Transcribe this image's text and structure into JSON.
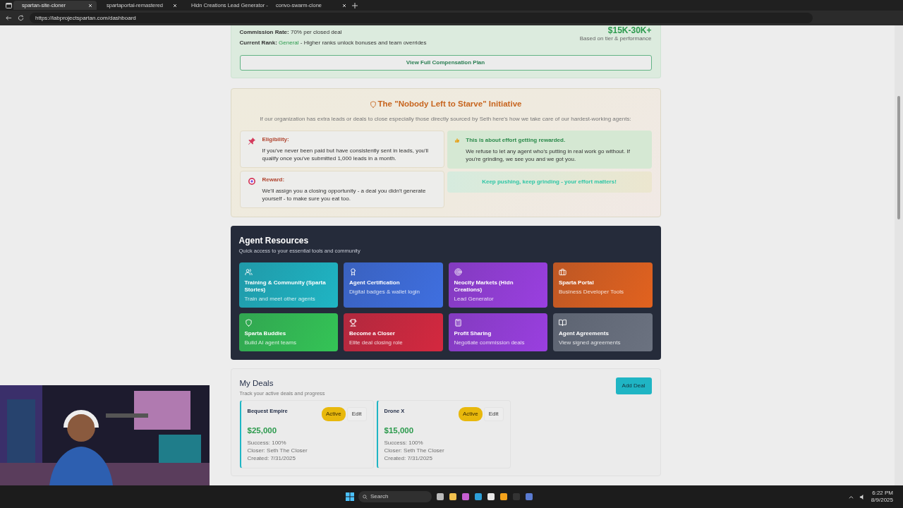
{
  "browser": {
    "tabs": [
      {
        "title": "spartan-site-cloner",
        "selected": true
      },
      {
        "title": "spartaportal-remastered",
        "selected": false
      },
      {
        "title": "Hidn Creations Lead Generator -",
        "selected": false
      },
      {
        "title": "convo-swarm-clone",
        "selected": false
      }
    ],
    "url": "https://labprojectspartan.com/dashboard"
  },
  "compensation": {
    "lines": [
      {
        "label": "Commission Rate:",
        "text": "70% per closed deal"
      },
      {
        "label": "Current Rank:",
        "highlight": "General",
        "text": "- Higher ranks unlock bonuses and team overrides"
      }
    ],
    "earnings": "$15K-30K+",
    "earnings_note": "Based on tier & performance",
    "button": "View Full Compensation Plan"
  },
  "initiative": {
    "title": "The \"Nobody Left to Starve\" Initiative",
    "intro": "If our organization has extra leads or deals to close especially those directly sourced by Seth here's how we take care of our hardest-working agents:",
    "left": [
      {
        "kind": "pin",
        "title": "Eligibility:",
        "text": "If you've never been paid but have consistently sent in leads, you'll qualify once you've submitted 1,000 leads in a month."
      },
      {
        "kind": "target",
        "title": "Reward:",
        "text": "We'll assign you a closing opportunity - a deal you didn't generate yourself - to make sure you eat too."
      }
    ],
    "highlight": {
      "title": "This is about effort getting rewarded.",
      "text": "We refuse to let any agent who's putting in real work go without. If you're grinding, we see you and we got you."
    },
    "motto": "Keep pushing, keep grinding - your effort matters!"
  },
  "resources": {
    "title": "Agent Resources",
    "subtitle": "Quick access to your essential tools and community",
    "tiles": [
      {
        "kind": "users",
        "title": "Training & Community (Sparta Stories)",
        "subtitle": "Train and meet other agents",
        "color": "#1fb5c4"
      },
      {
        "kind": "award",
        "title": "Agent Certification",
        "subtitle": "Digital badges & wallet login",
        "color": "#3f6fe0"
      },
      {
        "kind": "target",
        "title": "Neocity Markets (Hidn Creations)",
        "subtitle": "Lead Generator",
        "color": "#9a3fe0"
      },
      {
        "kind": "briefcase",
        "title": "Sparta Portal",
        "subtitle": "Business Developer Tools",
        "color": "#e2621f"
      },
      {
        "kind": "shield",
        "title": "Sparta Buddies",
        "subtitle": "Build AI agent teams",
        "color": "#34c456"
      },
      {
        "kind": "trophy",
        "title": "Become a Closer",
        "subtitle": "Elite deal closing role",
        "color": "#d4283f"
      },
      {
        "kind": "calculator",
        "title": "Profit Sharing",
        "subtitle": "Negotiate commission deals",
        "color": "#9a3fe0"
      },
      {
        "kind": "book",
        "title": "Agent Agreements",
        "subtitle": "View signed agreements",
        "color": "#6b7280"
      }
    ]
  },
  "deals": {
    "title": "My Deals",
    "subtitle": "Track your active deals and progress",
    "add_button": "Add Deal",
    "items": [
      {
        "name": "Bequest Empire",
        "status": "Active",
        "edit": "Edit",
        "amount": "$25,000",
        "details": [
          "Success: 100%",
          "Closer: Seth The Closer",
          "Created: 7/31/2025"
        ]
      },
      {
        "name": "Drone X",
        "status": "Active",
        "edit": "Edit",
        "amount": "$15,000",
        "details": [
          "Success: 100%",
          "Closer: Seth The Closer",
          "Created: 7/31/2025"
        ]
      }
    ]
  },
  "taskbar": {
    "search": "Search",
    "time": "6:22 PM",
    "date": "8/9/2025"
  }
}
